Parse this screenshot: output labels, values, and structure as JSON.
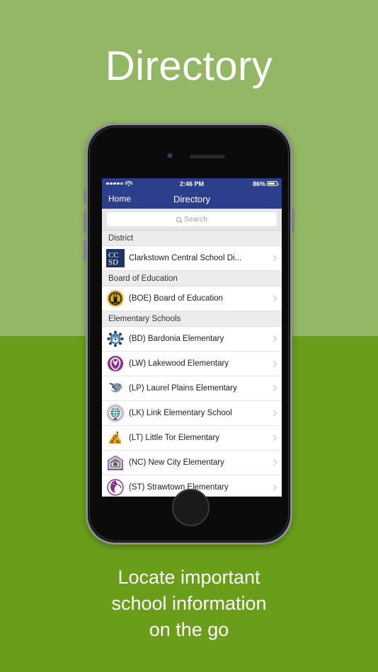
{
  "page": {
    "headline": "Directory",
    "caption_lines": [
      "Locate important",
      "school information",
      "on the go"
    ],
    "bg_top_color": "#93b765",
    "bg_bottom_color": "#6a9e1a"
  },
  "phone": {
    "device": "iphone",
    "camera_icon": "front-camera",
    "speaker_icon": "earpiece-speaker",
    "home_button_icon": "home-button"
  },
  "screen": {
    "statusbar": {
      "signal_icon": "signal-dots",
      "wifi_icon": "wifi-icon",
      "time": "2:46 PM",
      "battery_percent": "86%",
      "battery_icon": "battery-icon",
      "battery_level": 86
    },
    "navbar": {
      "back_label": "Home",
      "title": "Directory",
      "accent_color": "#2b3f8c"
    },
    "search": {
      "placeholder": "Search",
      "icon": "search-icon"
    },
    "sections": [
      {
        "header": "District",
        "rows": [
          {
            "label": "Clarkstown Central School Di...",
            "icon": "ccsd-logo",
            "chevron": "chevron-right-icon"
          }
        ]
      },
      {
        "header": "Board of Education",
        "rows": [
          {
            "label": "(BOE) Board of Education",
            "icon": "boe-seal-logo",
            "chevron": "chevron-right-icon"
          }
        ]
      },
      {
        "header": "Elementary Schools",
        "rows": [
          {
            "label": "(BD) Bardonia Elementary",
            "icon": "bardonia-bulldog-logo",
            "chevron": "chevron-right-icon"
          },
          {
            "label": "(LW) Lakewood Elementary",
            "icon": "lakewood-lion-logo",
            "chevron": "chevron-right-icon"
          },
          {
            "label": "(LP) Laurel Plains Elementary",
            "icon": "laurel-plains-eagle-logo",
            "chevron": "chevron-right-icon"
          },
          {
            "label": "(LK) Link Elementary School",
            "icon": "link-globe-logo",
            "chevron": "chevron-right-icon"
          },
          {
            "label": "(LT) Little Tor Elementary",
            "icon": "little-tor-tiger-logo",
            "chevron": "chevron-right-icon"
          },
          {
            "label": "(NC) New City Elementary",
            "icon": "new-city-schoolhouse-logo",
            "chevron": "chevron-right-icon"
          },
          {
            "label": "(ST) Strawtown Elementary",
            "icon": "strawtown-horse-logo",
            "chevron": "chevron-right-icon"
          }
        ]
      }
    ]
  }
}
